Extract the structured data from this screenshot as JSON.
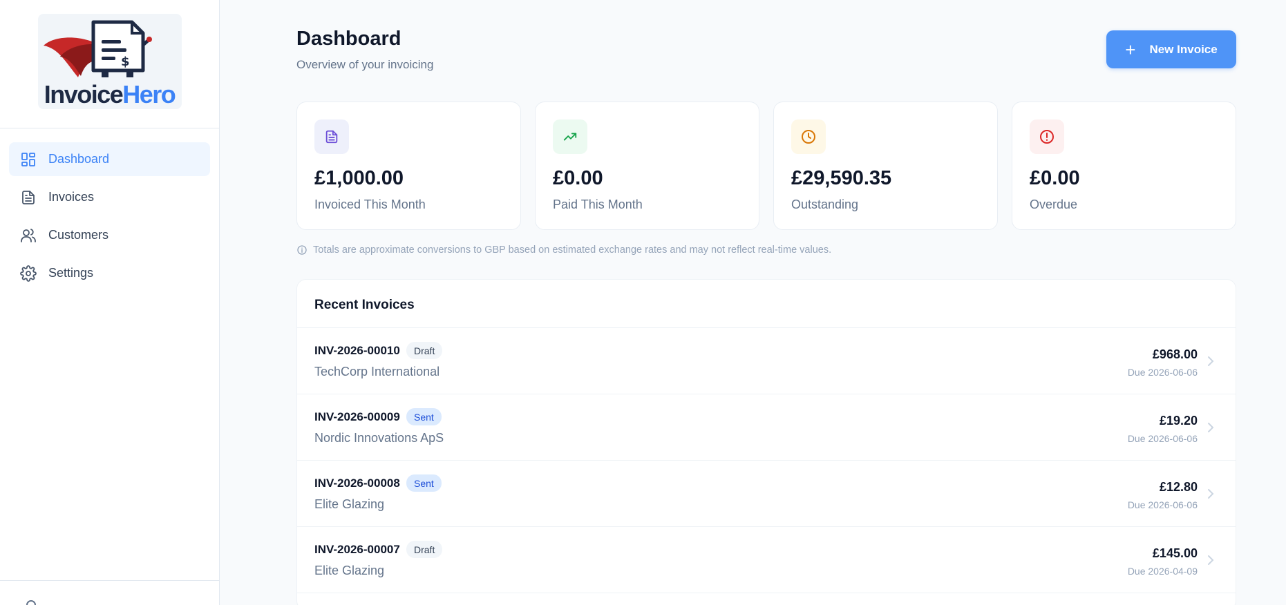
{
  "app": {
    "logo_word1": "Invoice",
    "logo_word2": "Hero"
  },
  "sidebar": {
    "items": [
      {
        "label": "Dashboard",
        "icon": "dashboard-grid-icon",
        "active": true
      },
      {
        "label": "Invoices",
        "icon": "document-icon",
        "active": false
      },
      {
        "label": "Customers",
        "icon": "users-icon",
        "active": false
      },
      {
        "label": "Settings",
        "icon": "gear-icon",
        "active": false
      }
    ]
  },
  "header": {
    "title": "Dashboard",
    "subtitle": "Overview of your invoicing",
    "new_invoice_label": "New Invoice"
  },
  "stats": [
    {
      "amount": "£1,000.00",
      "label": "Invoiced This Month",
      "icon": "document-icon",
      "color": "#6d4fd8",
      "bg": "#eef0fb"
    },
    {
      "amount": "£0.00",
      "label": "Paid This Month",
      "icon": "trending-up-icon",
      "color": "#16a34a",
      "bg": "#ecfaf1"
    },
    {
      "amount": "£29,590.35",
      "label": "Outstanding",
      "icon": "clock-icon",
      "color": "#d97706",
      "bg": "#fef8e7"
    },
    {
      "amount": "£0.00",
      "label": "Overdue",
      "icon": "alert-circle-icon",
      "color": "#dc2626",
      "bg": "#fdf0f0"
    }
  ],
  "note": "Totals are approximate conversions to GBP based on estimated exchange rates and may not reflect real-time values.",
  "recent": {
    "title": "Recent Invoices",
    "rows": [
      {
        "number": "INV-2026-00010",
        "status": "Draft",
        "customer": "TechCorp International",
        "amount": "£968.00",
        "due": "Due 2026-06-06"
      },
      {
        "number": "INV-2026-00009",
        "status": "Sent",
        "customer": "Nordic Innovations ApS",
        "amount": "£19.20",
        "due": "Due 2026-06-06"
      },
      {
        "number": "INV-2026-00008",
        "status": "Sent",
        "customer": "Elite Glazing",
        "amount": "£12.80",
        "due": "Due 2026-06-06"
      },
      {
        "number": "INV-2026-00007",
        "status": "Draft",
        "customer": "Elite Glazing",
        "amount": "£145.00",
        "due": "Due 2026-04-09"
      }
    ]
  },
  "colors": {
    "accent": "#3b82f6",
    "button": "#4f94f7"
  }
}
